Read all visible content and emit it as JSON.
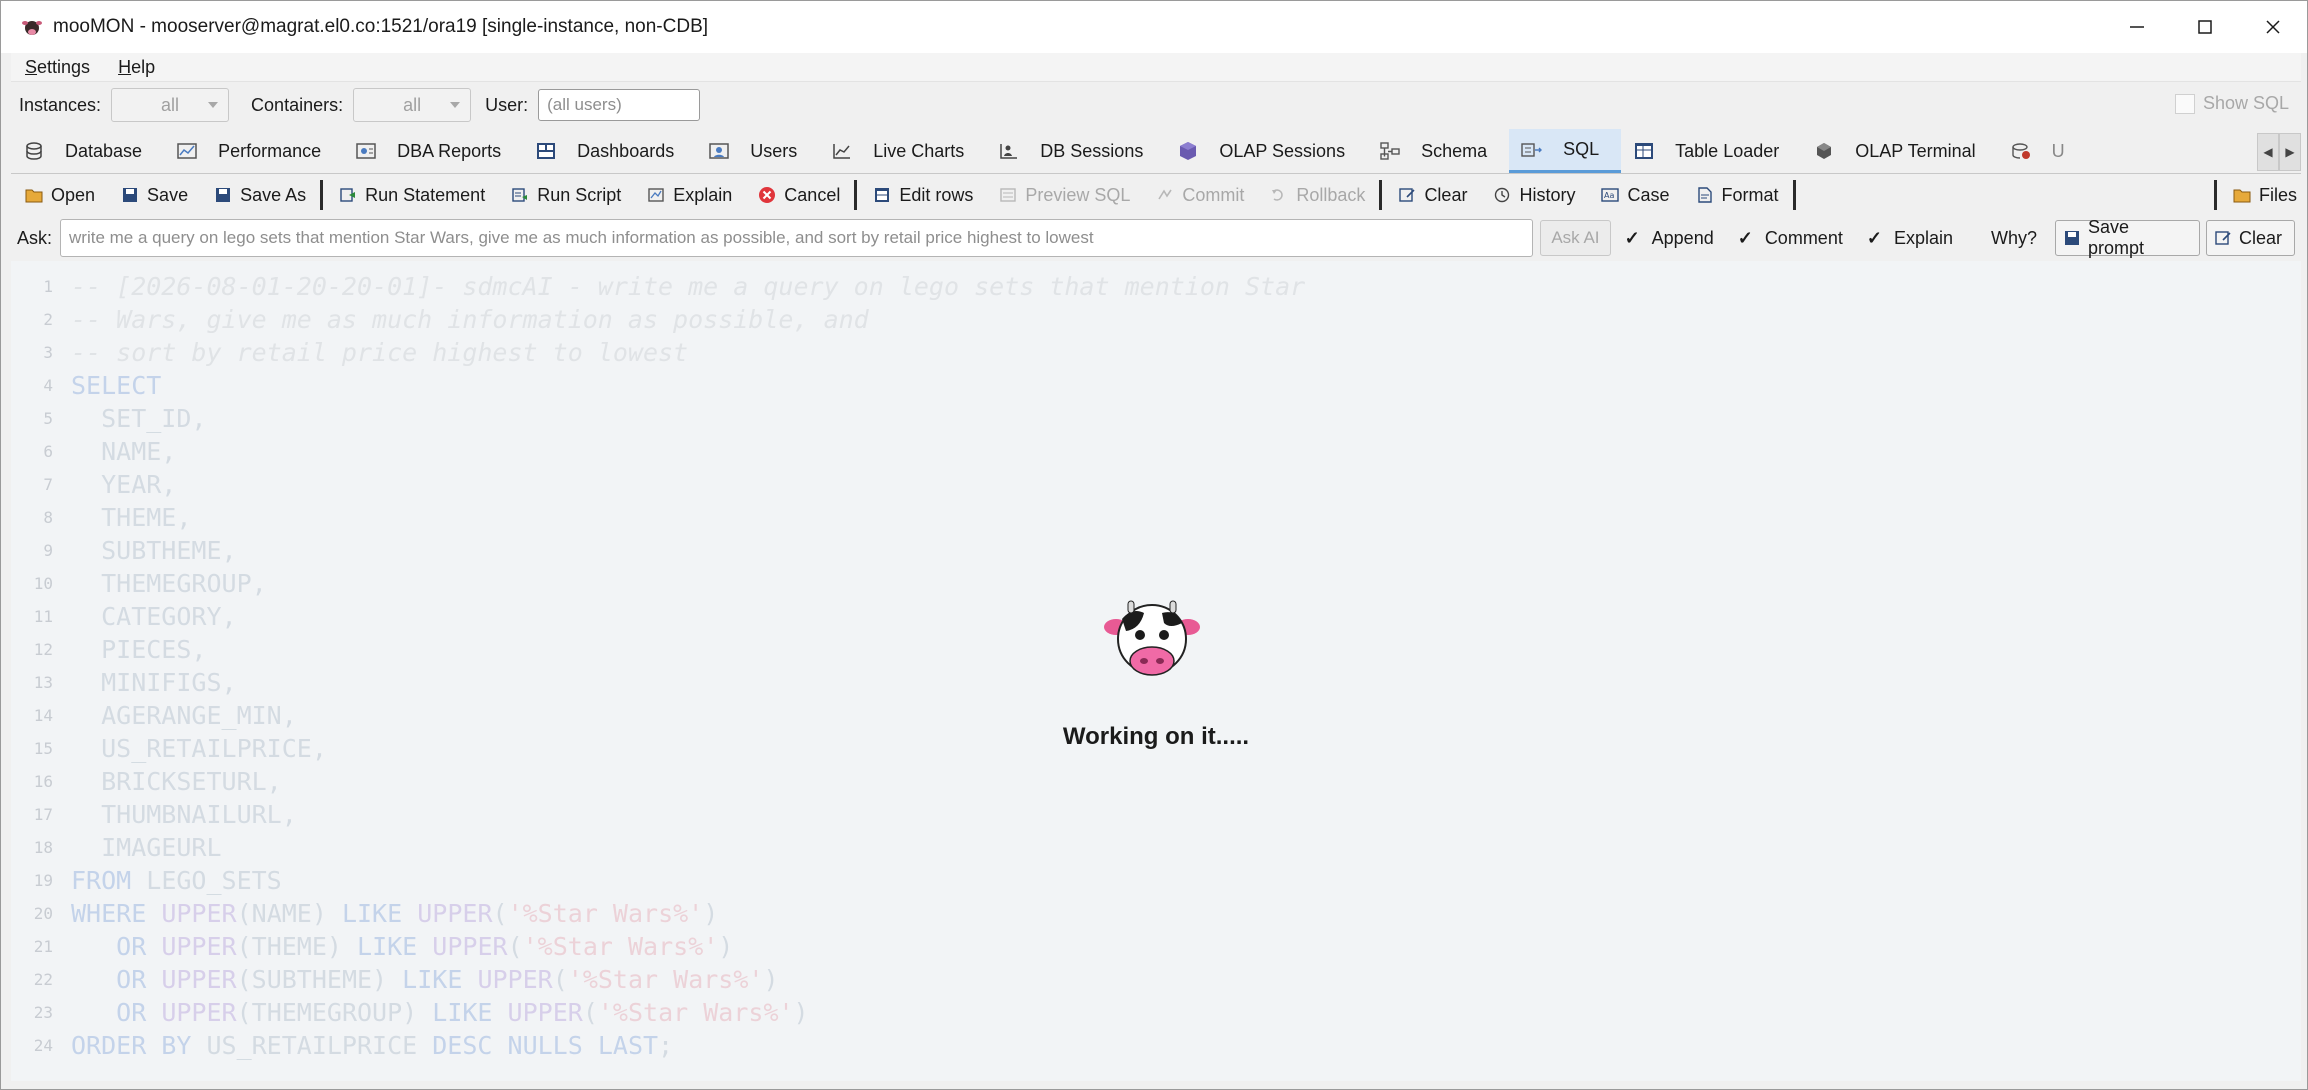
{
  "window": {
    "title": "mooMON - mooserver@magrat.el0.co:1521/ora19  [single-instance, non-CDB]"
  },
  "menu": {
    "items": [
      {
        "label": "Settings",
        "mnemonic": "S",
        "rest": "ettings"
      },
      {
        "label": "Help",
        "mnemonic": "H",
        "rest": "elp"
      }
    ]
  },
  "filters": {
    "instances_label": "Instances:",
    "instances_value": "all",
    "containers_label": "Containers:",
    "containers_value": "all",
    "user_label": "User:",
    "user_placeholder": "(all users)",
    "show_sql_label": "Show SQL"
  },
  "tabs": [
    {
      "label": "Database",
      "icon": "database-icon"
    },
    {
      "label": "Performance",
      "icon": "performance-icon"
    },
    {
      "label": "DBA Reports",
      "icon": "reports-icon"
    },
    {
      "label": "Dashboards",
      "icon": "dashboard-icon"
    },
    {
      "label": "Users",
      "icon": "users-icon"
    },
    {
      "label": "Live Charts",
      "icon": "chart-icon"
    },
    {
      "label": "DB Sessions",
      "icon": "sessions-icon"
    },
    {
      "label": "OLAP Sessions",
      "icon": "olap-icon"
    },
    {
      "label": "Schema",
      "icon": "schema-icon"
    },
    {
      "label": "SQL",
      "icon": "sql-icon",
      "active": true
    },
    {
      "label": "Table Loader",
      "icon": "table-loader-icon"
    },
    {
      "label": "OLAP Terminal",
      "icon": "terminal-icon"
    },
    {
      "label": "U",
      "icon": "utility-icon"
    }
  ],
  "toolbar": {
    "open": "Open",
    "save": "Save",
    "save_as": "Save As",
    "run_statement": "Run Statement",
    "run_script": "Run Script",
    "explain": "Explain",
    "cancel": "Cancel",
    "edit_rows": "Edit rows",
    "preview_sql": "Preview SQL",
    "commit": "Commit",
    "rollback": "Rollback",
    "clear": "Clear",
    "history": "History",
    "case": "Case",
    "format": "Format",
    "files": "Files"
  },
  "ask": {
    "label": "Ask:",
    "value": "write me a query on lego sets that mention Star Wars, give me as much information as possible, and sort by retail price highest to lowest",
    "ask_ai": "Ask AI",
    "append": "Append",
    "comment": "Comment",
    "explain": "Explain",
    "why": "Why?",
    "save_prompt": "Save prompt",
    "clear": "Clear"
  },
  "editor": {
    "lines": [
      {
        "n": "1",
        "parts": [
          {
            "t": "-- [2026-08-01-20-20-01]- sdmcAI - write me a query on lego sets that mention Star",
            "c": "ccomment"
          }
        ]
      },
      {
        "n": "2",
        "parts": [
          {
            "t": "-- Wars, give me as much information as possible, and",
            "c": "ccomment"
          }
        ]
      },
      {
        "n": "3",
        "parts": [
          {
            "t": "-- sort by retail price highest to lowest",
            "c": "ccomment"
          }
        ]
      },
      {
        "n": "4",
        "parts": [
          {
            "t": "SELECT",
            "c": "ckw"
          }
        ]
      },
      {
        "n": "5",
        "parts": [
          {
            "t": "  SET_ID,",
            "c": "ctext"
          }
        ]
      },
      {
        "n": "6",
        "parts": [
          {
            "t": "  NAME,",
            "c": "ctext"
          }
        ]
      },
      {
        "n": "7",
        "parts": [
          {
            "t": "  YEAR,",
            "c": "ctext"
          }
        ]
      },
      {
        "n": "8",
        "parts": [
          {
            "t": "  THEME,",
            "c": "ctext"
          }
        ]
      },
      {
        "n": "9",
        "parts": [
          {
            "t": "  SUBTHEME,",
            "c": "ctext"
          }
        ]
      },
      {
        "n": "10",
        "parts": [
          {
            "t": "  THEMEGROUP,",
            "c": "ctext"
          }
        ]
      },
      {
        "n": "11",
        "parts": [
          {
            "t": "  CATEGORY,",
            "c": "ctext"
          }
        ]
      },
      {
        "n": "12",
        "parts": [
          {
            "t": "  PIECES,",
            "c": "ctext"
          }
        ]
      },
      {
        "n": "13",
        "parts": [
          {
            "t": "  MINIFIGS,",
            "c": "ctext"
          }
        ]
      },
      {
        "n": "14",
        "parts": [
          {
            "t": "  AGERANGE_MIN,",
            "c": "ctext"
          }
        ]
      },
      {
        "n": "15",
        "parts": [
          {
            "t": "  US_RETAILPRICE,",
            "c": "ctext"
          }
        ]
      },
      {
        "n": "16",
        "parts": [
          {
            "t": "  BRICKSETURL,",
            "c": "ctext"
          }
        ]
      },
      {
        "n": "17",
        "parts": [
          {
            "t": "  THUMBNAILURL,",
            "c": "ctext"
          }
        ]
      },
      {
        "n": "18",
        "parts": [
          {
            "t": "  IMAGEURL",
            "c": "ctext"
          }
        ]
      },
      {
        "n": "19",
        "parts": [
          {
            "t": "FROM",
            "c": "ckw"
          },
          {
            "t": " LEGO_SETS",
            "c": "ctext"
          }
        ]
      },
      {
        "n": "20",
        "parts": [
          {
            "t": "WHERE",
            "c": "ckw"
          },
          {
            "t": " ",
            "c": "ctext"
          },
          {
            "t": "UPPER",
            "c": "cfn"
          },
          {
            "t": "(NAME) ",
            "c": "ctext"
          },
          {
            "t": "LIKE",
            "c": "ckw"
          },
          {
            "t": " ",
            "c": "ctext"
          },
          {
            "t": "UPPER",
            "c": "cfn"
          },
          {
            "t": "(",
            "c": "ctext"
          },
          {
            "t": "'%Star Wars%'",
            "c": "cstr"
          },
          {
            "t": ")",
            "c": "ctext"
          }
        ]
      },
      {
        "n": "21",
        "parts": [
          {
            "t": "   ",
            "c": "ctext"
          },
          {
            "t": "OR",
            "c": "ckw"
          },
          {
            "t": " ",
            "c": "ctext"
          },
          {
            "t": "UPPER",
            "c": "cfn"
          },
          {
            "t": "(THEME) ",
            "c": "ctext"
          },
          {
            "t": "LIKE",
            "c": "ckw"
          },
          {
            "t": " ",
            "c": "ctext"
          },
          {
            "t": "UPPER",
            "c": "cfn"
          },
          {
            "t": "(",
            "c": "ctext"
          },
          {
            "t": "'%Star Wars%'",
            "c": "cstr"
          },
          {
            "t": ")",
            "c": "ctext"
          }
        ]
      },
      {
        "n": "22",
        "parts": [
          {
            "t": "   ",
            "c": "ctext"
          },
          {
            "t": "OR",
            "c": "ckw"
          },
          {
            "t": " ",
            "c": "ctext"
          },
          {
            "t": "UPPER",
            "c": "cfn"
          },
          {
            "t": "(SUBTHEME) ",
            "c": "ctext"
          },
          {
            "t": "LIKE",
            "c": "ckw"
          },
          {
            "t": " ",
            "c": "ctext"
          },
          {
            "t": "UPPER",
            "c": "cfn"
          },
          {
            "t": "(",
            "c": "ctext"
          },
          {
            "t": "'%Star Wars%'",
            "c": "cstr"
          },
          {
            "t": ")",
            "c": "ctext"
          }
        ]
      },
      {
        "n": "23",
        "parts": [
          {
            "t": "   ",
            "c": "ctext"
          },
          {
            "t": "OR",
            "c": "ckw"
          },
          {
            "t": " ",
            "c": "ctext"
          },
          {
            "t": "UPPER",
            "c": "cfn"
          },
          {
            "t": "(THEMEGROUP) ",
            "c": "ctext"
          },
          {
            "t": "LIKE",
            "c": "ckw"
          },
          {
            "t": " ",
            "c": "ctext"
          },
          {
            "t": "UPPER",
            "c": "cfn"
          },
          {
            "t": "(",
            "c": "ctext"
          },
          {
            "t": "'%Star Wars%'",
            "c": "cstr"
          },
          {
            "t": ")",
            "c": "ctext"
          }
        ]
      },
      {
        "n": "24",
        "parts": [
          {
            "t": "ORDER BY",
            "c": "ckw"
          },
          {
            "t": " US_RETAILPRICE ",
            "c": "ctext"
          },
          {
            "t": "DESC",
            "c": "ckw"
          },
          {
            "t": " ",
            "c": "ctext"
          },
          {
            "t": "NULLS LAST",
            "c": "ckw"
          },
          {
            "t": ";",
            "c": "ctext"
          }
        ]
      }
    ]
  },
  "overlay": {
    "icon": "cow-icon",
    "message": "Working on it....."
  },
  "colors": {
    "active_tab": "#d9e7f6",
    "active_tab_border": "#5a9bd8",
    "cancel_red": "#e0353b"
  }
}
